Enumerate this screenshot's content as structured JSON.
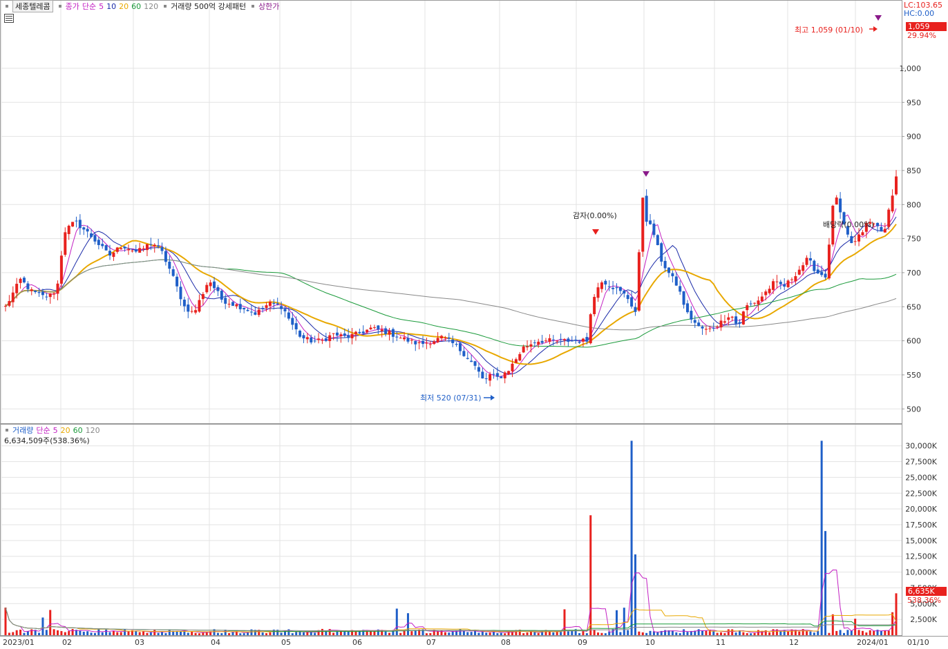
{
  "header": {
    "stock_name": "세종텔레콤",
    "price_indicator": "종가",
    "ma_type": "단순",
    "ma_periods": [
      "5",
      "10",
      "20",
      "60",
      "120"
    ],
    "extra_items": [
      "거래량 500억 강세패턴",
      "상한가"
    ]
  },
  "right_panel": {
    "lc": "LC:103.65",
    "hc": "HC:0.00",
    "last_price": "1,059",
    "last_change": "29.94%",
    "vol_last": "6,635K",
    "vol_pct": "538.36%"
  },
  "annotations": {
    "high": "최고 1,059 (01/10)",
    "low": "최저 520 (07/31)",
    "reduction": "감자(0.00%)",
    "dividend": "배당락(0.00%)"
  },
  "volume_panel": {
    "label": "거래량",
    "ma_type": "단순",
    "ma_periods": [
      "5",
      "20",
      "60",
      "120"
    ],
    "current": "6,634,509주(538.36%)"
  },
  "colors": {
    "up": "#e8211e",
    "down": "#1f5fc8",
    "ma5": "#c21ec2",
    "ma10": "#1a2aa8",
    "ma20": "#e8a800",
    "ma60": "#1a9a3a",
    "ma120": "#888888",
    "grid": "#e3e3e3"
  },
  "chart_data": {
    "type": "candlestick",
    "price_axis": {
      "min": 480,
      "max": 1080,
      "ticks": [
        500,
        550,
        600,
        650,
        700,
        750,
        800,
        850,
        900,
        950,
        1000
      ]
    },
    "volume_axis": {
      "min": 0,
      "max": 31500,
      "unit": "K",
      "ticks": [
        2500,
        5000,
        7500,
        10000,
        12500,
        15000,
        17500,
        20000,
        22500,
        25000,
        27500,
        30000
      ]
    },
    "x_labels": [
      "2023/01",
      "02",
      "03",
      "04",
      "05",
      "06",
      "07",
      "08",
      "09",
      "10",
      "11",
      "12",
      "2024/01",
      "01/10"
    ],
    "anchors": [
      [
        0,
        650
      ],
      [
        8,
        690
      ],
      [
        14,
        672
      ],
      [
        20,
        665
      ],
      [
        25,
        668
      ],
      [
        28,
        685
      ],
      [
        31,
        760
      ],
      [
        37,
        775
      ],
      [
        45,
        755
      ],
      [
        55,
        725
      ],
      [
        62,
        740
      ],
      [
        70,
        730
      ],
      [
        78,
        745
      ],
      [
        83,
        730
      ],
      [
        88,
        700
      ],
      [
        95,
        650
      ],
      [
        100,
        640
      ],
      [
        108,
        690
      ],
      [
        115,
        660
      ],
      [
        125,
        650
      ],
      [
        133,
        640
      ],
      [
        140,
        655
      ],
      [
        147,
        650
      ],
      [
        152,
        625
      ],
      [
        157,
        605
      ],
      [
        162,
        600
      ],
      [
        168,
        600
      ],
      [
        174,
        610
      ],
      [
        181,
        605
      ],
      [
        187,
        610
      ],
      [
        194,
        618
      ],
      [
        200,
        615
      ],
      [
        207,
        608
      ],
      [
        214,
        600
      ],
      [
        220,
        595
      ],
      [
        227,
        600
      ],
      [
        232,
        605
      ],
      [
        238,
        595
      ],
      [
        244,
        580
      ],
      [
        250,
        560
      ],
      [
        254,
        540
      ],
      [
        257,
        550
      ],
      [
        262,
        545
      ],
      [
        268,
        560
      ],
      [
        275,
        590
      ],
      [
        282,
        600
      ],
      [
        290,
        600
      ],
      [
        300,
        600
      ],
      [
        309,
        600
      ],
      [
        311,
        650
      ],
      [
        316,
        690
      ],
      [
        322,
        680
      ],
      [
        330,
        665
      ],
      [
        335,
        640
      ],
      [
        338,
        820
      ],
      [
        340,
        780
      ],
      [
        344,
        760
      ],
      [
        348,
        720
      ],
      [
        352,
        700
      ],
      [
        357,
        680
      ],
      [
        362,
        640
      ],
      [
        368,
        620
      ],
      [
        373,
        615
      ],
      [
        379,
        625
      ],
      [
        385,
        640
      ],
      [
        389,
        620
      ],
      [
        393,
        650
      ],
      [
        400,
        660
      ],
      [
        408,
        685
      ],
      [
        414,
        680
      ],
      [
        420,
        700
      ],
      [
        426,
        720
      ],
      [
        431,
        700
      ],
      [
        436,
        695
      ],
      [
        440,
        820
      ],
      [
        443,
        790
      ],
      [
        446,
        760
      ],
      [
        450,
        740
      ],
      [
        455,
        760
      ],
      [
        458,
        775
      ],
      [
        462,
        770
      ],
      [
        467,
        760
      ],
      [
        470,
        805
      ],
      [
        473,
        840
      ]
    ]
  }
}
